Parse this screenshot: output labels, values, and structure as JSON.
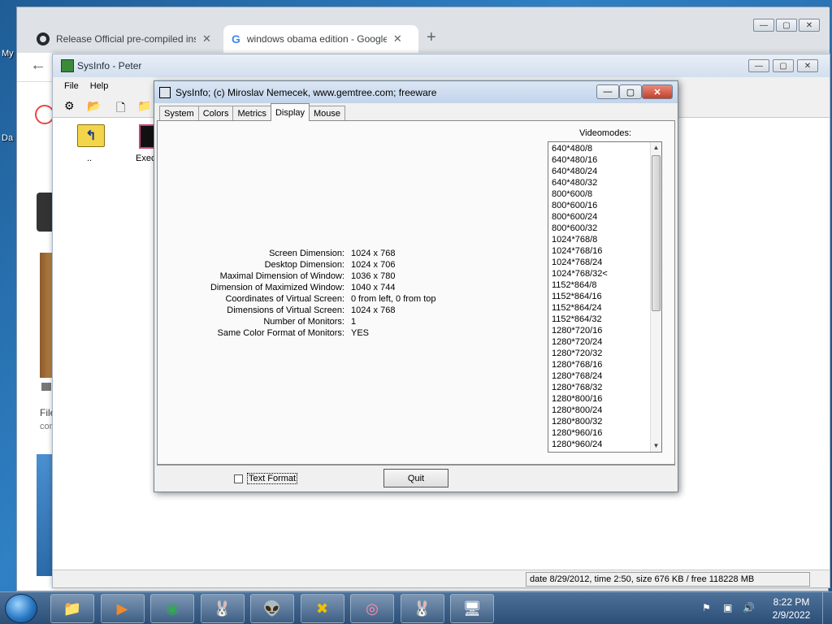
{
  "desktop": {
    "labels": [
      "My",
      "Da"
    ]
  },
  "chrome": {
    "tabs": [
      {
        "title": "Release Official pre-compiled ins",
        "icon": "github-icon"
      },
      {
        "title": "windows obama edition - Google",
        "icon": "google-icon"
      }
    ],
    "new_tab": "+",
    "back": "←"
  },
  "fm": {
    "title": "SysInfo - Peter",
    "menu": [
      "File",
      "Help"
    ],
    "up_label": "..",
    "exec_label": "Exec",
    "status": "date 8/29/2012, time 2:50, size 676 KB / free 118228 MB",
    "left_partial": [
      "File",
      "con"
    ]
  },
  "sysinfo": {
    "title": "SysInfo;  (c) Miroslav Nemecek, www.gemtree.com;  freeware",
    "tabs": [
      "System",
      "Colors",
      "Metrics",
      "Display",
      "Mouse"
    ],
    "active_tab": "Display",
    "rows": [
      {
        "label": "Screen Dimension:",
        "value": "1024 x 768"
      },
      {
        "label": "Desktop Dimension:",
        "value": "1024 x 706"
      },
      {
        "label": "Maximal Dimension of Window:",
        "value": "1036 x 780"
      },
      {
        "label": "Dimension of Maximized Window:",
        "value": "1040 x 744"
      },
      {
        "label": "Coordinates of Virtual Screen:",
        "value": "0 from left, 0 from top"
      },
      {
        "label": "Dimensions of Virtual Screen:",
        "value": "1024 x 768"
      },
      {
        "label": "Number of Monitors:",
        "value": "1"
      },
      {
        "label": "Same Color Format of Monitors:",
        "value": "YES"
      }
    ],
    "videomodes_caption": "Videomodes:",
    "videomodes": [
      "640*480/8",
      "640*480/16",
      "640*480/24",
      "640*480/32",
      "800*600/8",
      "800*600/16",
      "800*600/24",
      "800*600/32",
      "1024*768/8",
      "1024*768/16",
      "1024*768/24",
      "1024*768/32<",
      "1152*864/8",
      "1152*864/16",
      "1152*864/24",
      "1152*864/32",
      "1280*720/16",
      "1280*720/24",
      "1280*720/32",
      "1280*768/16",
      "1280*768/24",
      "1280*768/32",
      "1280*800/16",
      "1280*800/24",
      "1280*800/32",
      "1280*960/16",
      "1280*960/24"
    ],
    "text_format_label": "Text Format",
    "text_format_checked": false,
    "quit_label": "Quit"
  },
  "taskbar": {
    "time": "8:22 PM",
    "date": "2/9/2022",
    "apps": [
      "explorer-icon",
      "media-player-icon",
      "chrome-icon",
      "rabbit-icon",
      "alien-icon",
      "x-game-icon",
      "donut-icon",
      "rabbit-icon",
      "computer-icon"
    ]
  }
}
